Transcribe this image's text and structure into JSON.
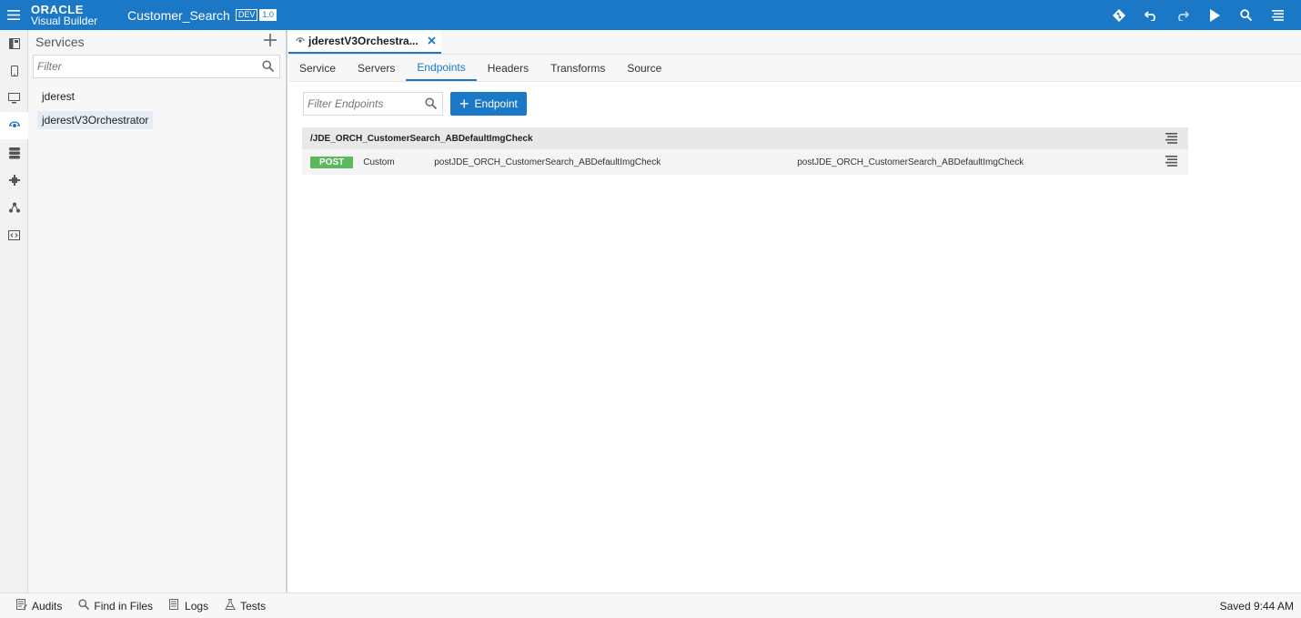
{
  "header": {
    "brand": "ORACLE",
    "product": "Visual Builder",
    "app_name": "Customer_Search",
    "env_tag": "DEV",
    "version_tag": "1.0",
    "accent": "#1b78c7",
    "actions": [
      "git-icon",
      "undo-icon",
      "redo-icon",
      "run-icon",
      "search-icon",
      "menu-icon"
    ]
  },
  "rail": {
    "items": [
      "navigator-icon",
      "mobile-icon",
      "desktop-icon",
      "service-icon",
      "database-icon",
      "component-icon",
      "process-icon",
      "source-icon"
    ],
    "active": "service-icon"
  },
  "services": {
    "title": "Services",
    "filter_placeholder": "Filter",
    "items": [
      {
        "label": "jderest"
      },
      {
        "label": "jderestV3Orchestrator",
        "selected": true
      }
    ]
  },
  "editor": {
    "file_tab": "jderestV3Orchestra...",
    "subtabs": [
      "Service",
      "Servers",
      "Endpoints",
      "Headers",
      "Transforms",
      "Source"
    ],
    "active_subtab": "Endpoints",
    "filter_placeholder": "Filter Endpoints",
    "add_endpoint_label": "Endpoint"
  },
  "endpoints": {
    "group_path": "/JDE_ORCH_CustomerSearch_ABDefaultImgCheck",
    "rows": [
      {
        "method": "POST",
        "type": "Custom",
        "id": "postJDE_ORCH_CustomerSearch_ABDefaultImgCheck",
        "name": "postJDE_ORCH_CustomerSearch_ABDefaultImgCheck"
      }
    ],
    "method_color": "#5cb85c"
  },
  "footer": {
    "items": [
      "Audits",
      "Find in Files",
      "Logs",
      "Tests"
    ],
    "status": "Saved 9:44 AM"
  }
}
